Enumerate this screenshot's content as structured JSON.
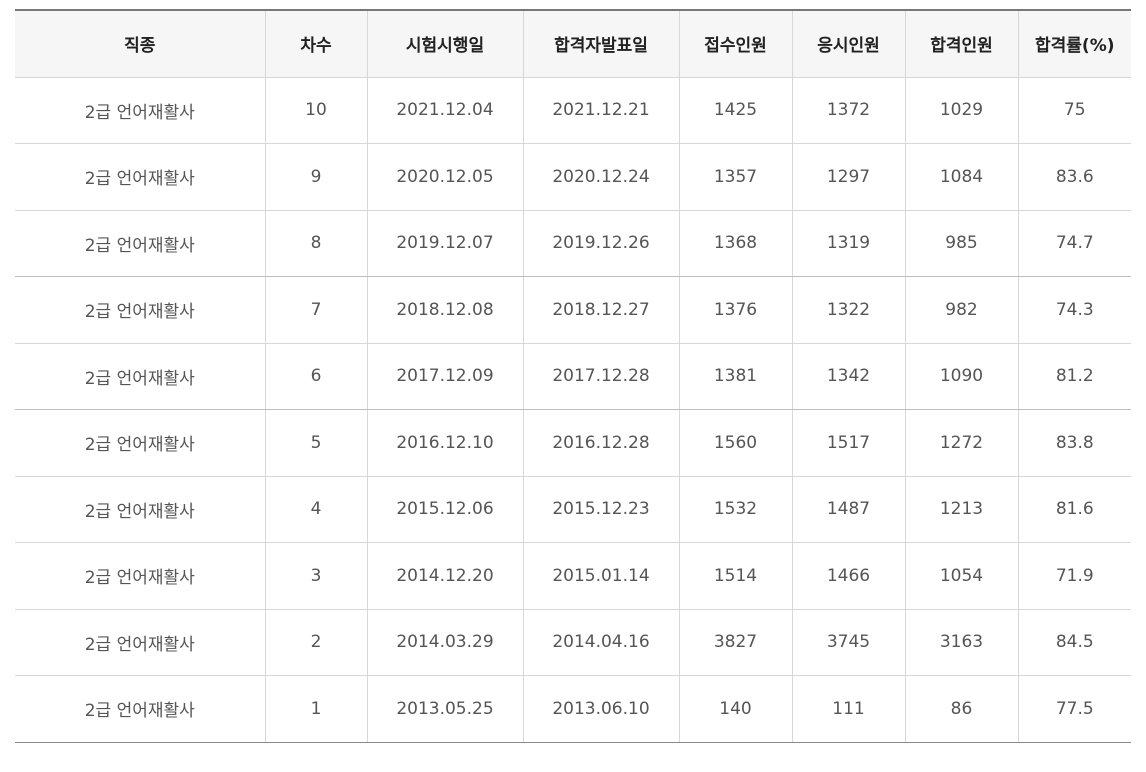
{
  "table": {
    "headers": [
      "직종",
      "차수",
      "시험시행일",
      "합격자발표일",
      "접수인원",
      "응시인원",
      "합격인원",
      "합격률(%)"
    ],
    "rows": [
      [
        "2급 언어재활사",
        "10",
        "2021.12.04",
        "2021.12.21",
        "1425",
        "1372",
        "1029",
        "75"
      ],
      [
        "2급 언어재활사",
        "9",
        "2020.12.05",
        "2020.12.24",
        "1357",
        "1297",
        "1084",
        "83.6"
      ],
      [
        "2급 언어재활사",
        "8",
        "2019.12.07",
        "2019.12.26",
        "1368",
        "1319",
        "985",
        "74.7"
      ],
      [
        "2급 언어재활사",
        "7",
        "2018.12.08",
        "2018.12.27",
        "1376",
        "1322",
        "982",
        "74.3"
      ],
      [
        "2급 언어재활사",
        "6",
        "2017.12.09",
        "2017.12.28",
        "1381",
        "1342",
        "1090",
        "81.2"
      ],
      [
        "2급 언어재활사",
        "5",
        "2016.12.10",
        "2016.12.28",
        "1560",
        "1517",
        "1272",
        "83.8"
      ],
      [
        "2급 언어재활사",
        "4",
        "2015.12.06",
        "2015.12.23",
        "1532",
        "1487",
        "1213",
        "81.6"
      ],
      [
        "2급 언어재활사",
        "3",
        "2014.12.20",
        "2015.01.14",
        "1514",
        "1466",
        "1054",
        "71.9"
      ],
      [
        "2급 언어재활사",
        "2",
        "2014.03.29",
        "2014.04.16",
        "3827",
        "3745",
        "3163",
        "84.5"
      ],
      [
        "2급 언어재활사",
        "1",
        "2013.05.25",
        "2013.06.10",
        "140",
        "111",
        "86",
        "77.5"
      ]
    ]
  },
  "colors": {
    "header_background": "#f6f6f6",
    "header_text": "#222222",
    "cell_text": "#555555",
    "border": "#d7d7d7",
    "top_rule": "#777777"
  }
}
